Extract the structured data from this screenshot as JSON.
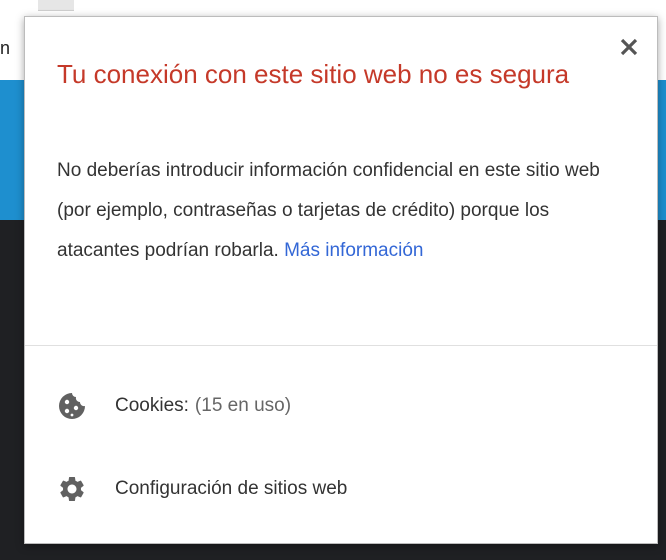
{
  "background": {
    "visible_letter": "n"
  },
  "popup": {
    "title": "Tu conexión con este sitio web no es segura",
    "description": "No deberías introducir información confidencial en este sitio web (por ejemplo, contraseñas o tarjetas de crédito) porque los atacantes podrían robarla.",
    "more_info_link": "Más información",
    "close_icon": "close-icon",
    "items": [
      {
        "label": "Cookies:",
        "detail": "(15 en uso)",
        "icon": "cookie-icon"
      },
      {
        "label": "Configuración de sitios web",
        "icon": "gear-icon"
      }
    ],
    "colors": {
      "title": "#c53929",
      "link": "#3367d6",
      "text": "#333333"
    }
  }
}
